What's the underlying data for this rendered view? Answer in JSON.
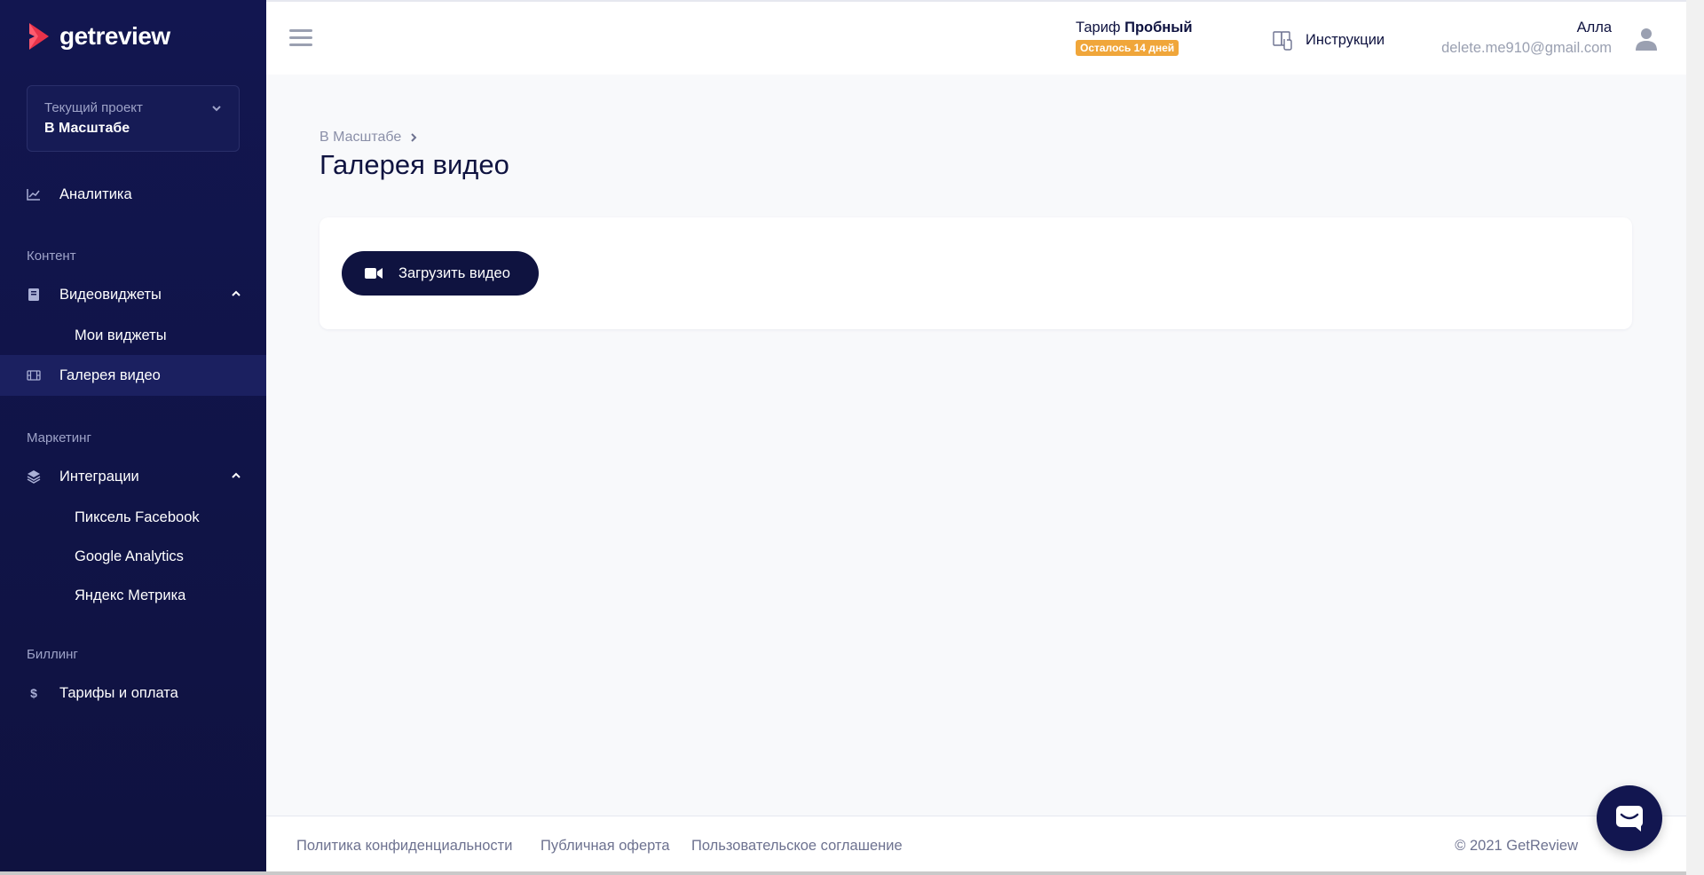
{
  "app": {
    "logo_text": "getreview"
  },
  "project": {
    "label": "Текущий проект",
    "name": "В Масштабе"
  },
  "sidebar": {
    "analytics": "Аналитика",
    "section_content": "Контент",
    "videowidgets": "Видеовиджеты",
    "my_widgets": "Мои виджеты",
    "gallery": "Галерея видео",
    "section_marketing": "Маркетинг",
    "integrations": "Интеграции",
    "fb_pixel": "Пиксель Facebook",
    "google_analytics": "Google Analytics",
    "yandex_metrika": "Яндекс Метрика",
    "section_billing": "Биллинг",
    "tariffs": "Тарифы и оплата"
  },
  "header": {
    "plan_prefix": "Тариф",
    "plan_name": "Пробный",
    "plan_badge": "Осталось 14 дней",
    "instructions": "Инструкции",
    "user_name": "Алла",
    "user_email": "delete.me910@gmail.com"
  },
  "main": {
    "breadcrumb": "В Масштабе",
    "title": "Галерея видео",
    "upload_button": "Загрузить видео"
  },
  "footer": {
    "privacy": "Политика конфиденциальности",
    "offer": "Публичная оферта",
    "agreement": "Пользовательское соглашение",
    "copyright": "© 2021 GetReview"
  },
  "colors": {
    "sidebar_bg": "#121650",
    "accent_red": "#e8334a",
    "badge": "#f0a63a",
    "page_bg": "#f8f9fb"
  }
}
